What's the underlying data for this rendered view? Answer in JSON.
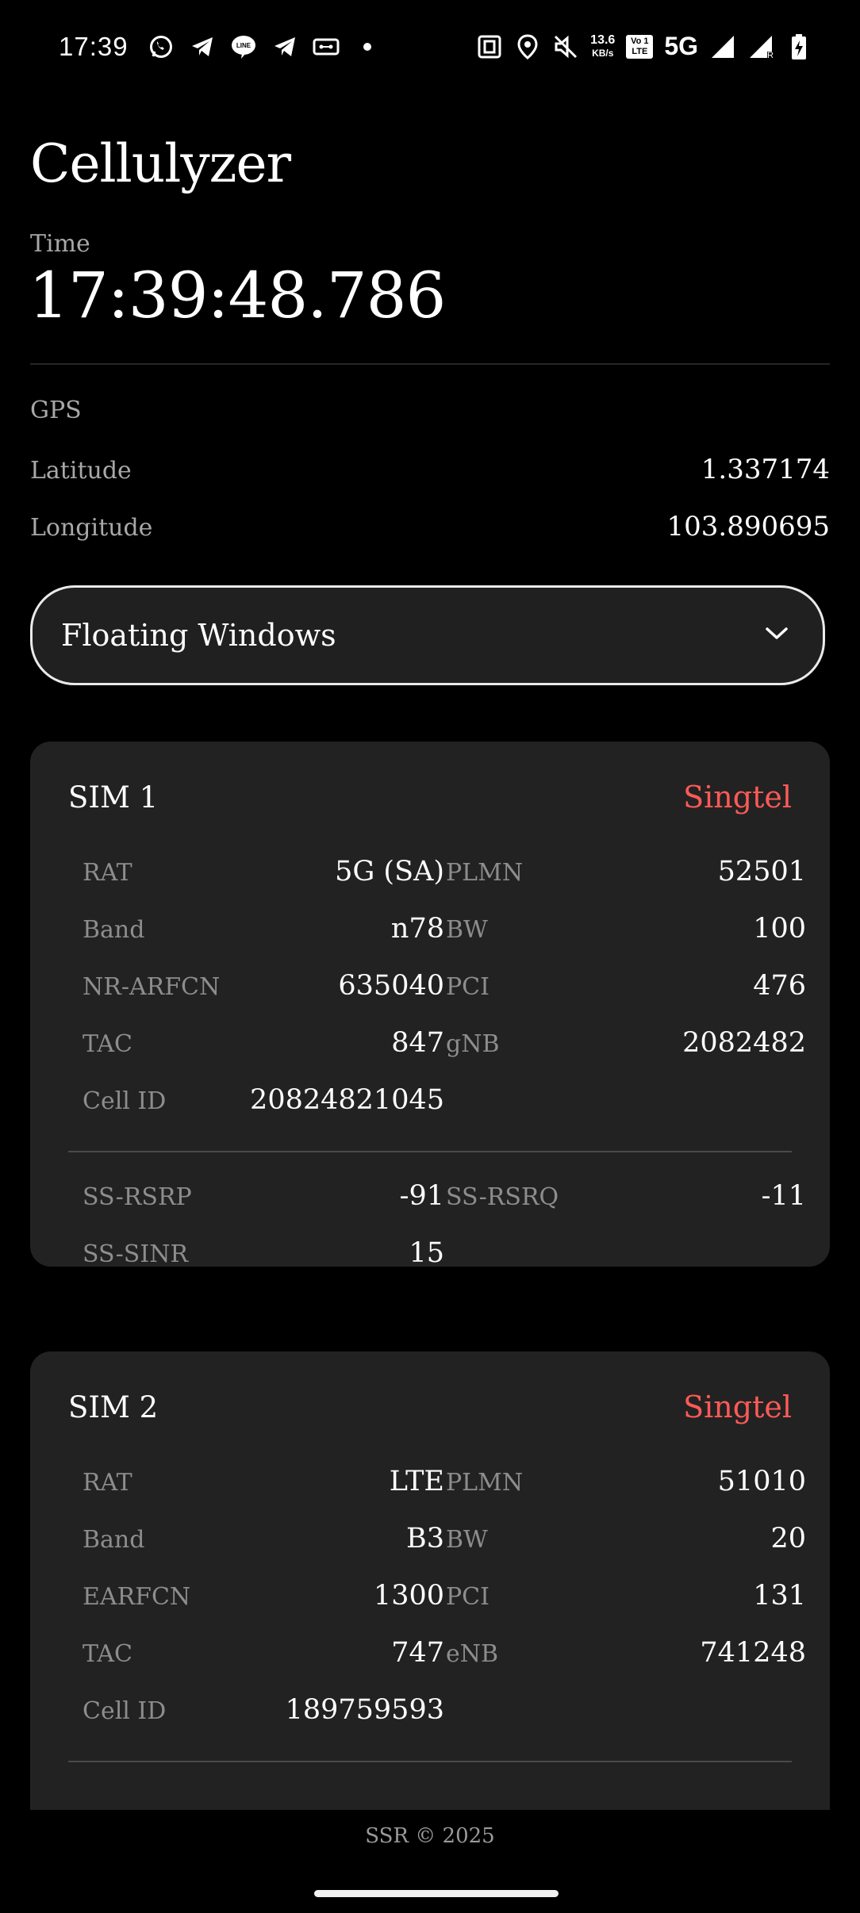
{
  "status_bar": {
    "time": "17:39",
    "speed_value": "13.6",
    "speed_unit": "KB/s",
    "volte_top": "Vo",
    "volte_num": "1",
    "volte_bottom": "LTE",
    "network": "5G",
    "roaming_mark": "R",
    "icons_left": [
      "whatsapp-icon",
      "telegram-icon",
      "line-icon",
      "telegram-icon",
      "voicemail-icon",
      "dot-icon"
    ],
    "icons_right": [
      "nfc-icon",
      "location-icon",
      "mute-icon",
      "speed-indicator",
      "volte-icon",
      "5g-label",
      "signal-icon",
      "signal-roaming-icon",
      "battery-charging-icon"
    ]
  },
  "header": {
    "title": "Cellulyzer",
    "time_label": "Time",
    "time_value": "17:39:48.786"
  },
  "gps": {
    "label": "GPS",
    "latitude_label": "Latitude",
    "latitude_value": "1.337174",
    "longitude_label": "Longitude",
    "longitude_value": "103.890695"
  },
  "dropdown": {
    "label": "Floating Windows",
    "icon": "chevron-down-icon"
  },
  "sim1": {
    "name": "SIM 1",
    "operator": "Singtel",
    "rows": [
      [
        {
          "k": "RAT",
          "v": "5G (SA)"
        },
        {
          "k": "PLMN",
          "v": "52501"
        }
      ],
      [
        {
          "k": "Band",
          "v": "n78"
        },
        {
          "k": "BW",
          "v": "100"
        }
      ],
      [
        {
          "k": "NR-ARFCN",
          "v": "635040"
        },
        {
          "k": "PCI",
          "v": "476"
        }
      ],
      [
        {
          "k": "TAC",
          "v": "847"
        },
        {
          "k": "gNB",
          "v": "2082482"
        }
      ],
      [
        {
          "k": "Cell ID",
          "v": "20824821045"
        }
      ]
    ],
    "signal_rows": [
      [
        {
          "k": "SS-RSRP",
          "v": "-91"
        },
        {
          "k": "SS-RSRQ",
          "v": "-11"
        }
      ],
      [
        {
          "k": "SS-SINR",
          "v": "15"
        }
      ]
    ]
  },
  "sim2": {
    "name": "SIM 2",
    "operator": "Singtel",
    "rows": [
      [
        {
          "k": "RAT",
          "v": "LTE"
        },
        {
          "k": "PLMN",
          "v": "51010"
        }
      ],
      [
        {
          "k": "Band",
          "v": "B3"
        },
        {
          "k": "BW",
          "v": "20"
        }
      ],
      [
        {
          "k": "EARFCN",
          "v": "1300"
        },
        {
          "k": "PCI",
          "v": "131"
        }
      ],
      [
        {
          "k": "TAC",
          "v": "747"
        },
        {
          "k": "eNB",
          "v": "741248"
        }
      ],
      [
        {
          "k": "Cell ID",
          "v": "189759593"
        }
      ]
    ]
  },
  "footer": {
    "text": "SSR © 2025"
  },
  "colors": {
    "background": "#000000",
    "card": "#222222",
    "operator": "#ff5a57",
    "label": "#8d8d8d"
  }
}
